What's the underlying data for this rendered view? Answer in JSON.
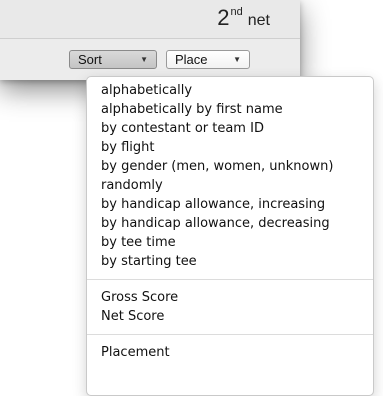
{
  "header": {
    "round_number": "2",
    "round_ordinal": "nd",
    "round_word": "net"
  },
  "toolbar": {
    "sort_label": "Sort",
    "place_label": "Place"
  },
  "icons": {
    "popup_arrow": "chevron-down-icon"
  },
  "sort_menu": {
    "sort_options": [
      "alphabetically",
      "alphabetically by first name",
      "by contestant or team ID",
      "by flight",
      "by gender (men, women, unknown)",
      "randomly",
      "by handicap allowance, increasing",
      "by handicap allowance, decreasing",
      "by tee time",
      "by starting tee"
    ],
    "score_options": [
      "Gross Score",
      "Net Score"
    ],
    "place_options": [
      "Placement"
    ]
  },
  "colors": {
    "window_bg": "#ececec",
    "menu_bg": "#ffffff",
    "separator": "#dcdcdc"
  }
}
